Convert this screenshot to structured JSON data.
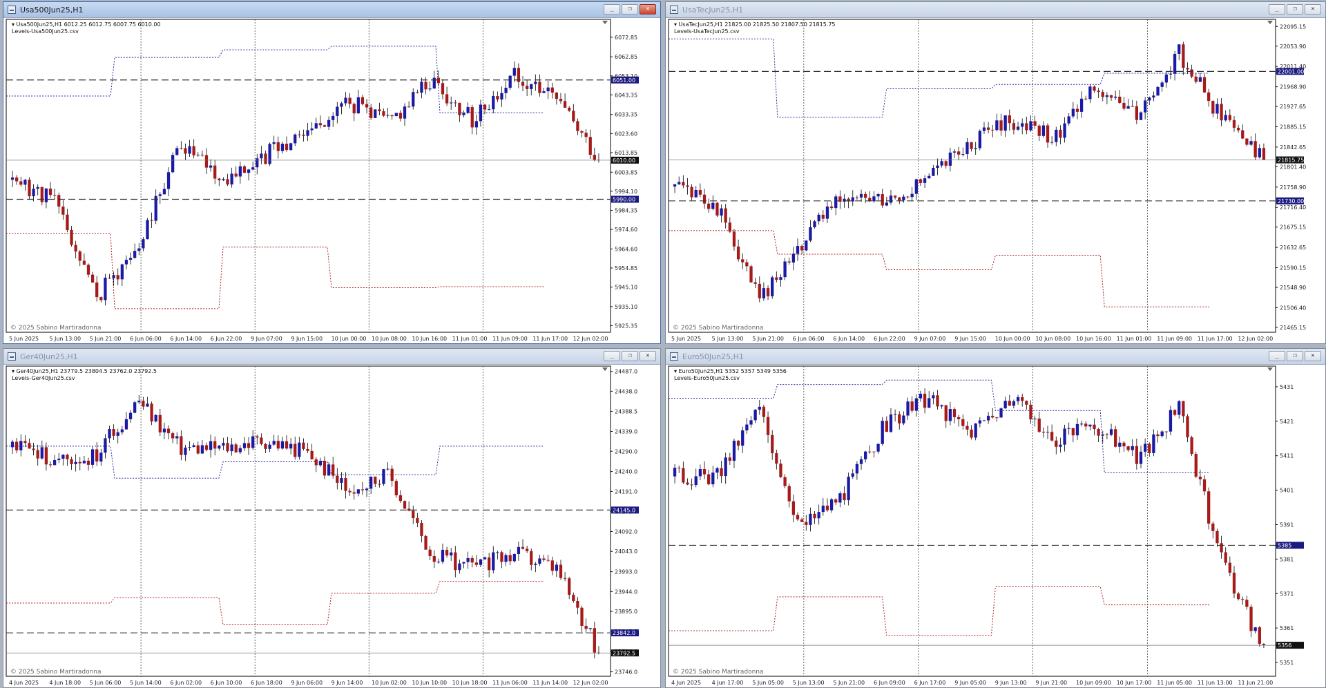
{
  "windows": [
    {
      "id": "w1",
      "title": "Usa500Jun25,H1",
      "active": true,
      "header_line": "Usa500Jun25,H1  6012.25 6012.75 6007.75 6010.00",
      "indicator": "Levels-Usa500Jun25.csv",
      "copyright": "© 2025 Sabino Martiradonna",
      "y_ticks": [
        "6072.85",
        "6062.85",
        "6053.10",
        "6043.35",
        "6033.35",
        "6023.60",
        "6013.85",
        "6003.85",
        "5994.10",
        "5984.35",
        "5974.60",
        "5964.60",
        "5954.85",
        "5945.10",
        "5935.10",
        "5925.35"
      ],
      "x_labels": [
        "5 Jun 2025",
        "5 Jun 13:00",
        "5 Jun 21:00",
        "6 Jun 06:00",
        "6 Jun 14:00",
        "6 Jun 22:00",
        "9 Jun 07:00",
        "9 Jun 15:00",
        "10 Jun 00:00",
        "10 Jun 08:00",
        "10 Jun 16:00",
        "11 Jun 01:00",
        "11 Jun 09:00",
        "11 Jun 17:00",
        "12 Jun 02:00"
      ],
      "levels": [
        {
          "value": 6051.0,
          "label": "6051.00"
        },
        {
          "value": 5990.0,
          "label": "5990.00"
        }
      ],
      "current_price": {
        "value": 6010.0,
        "label": "6010.00"
      },
      "ylim": [
        5922,
        6082
      ],
      "start": 6000,
      "trend": [
        6000,
        5990,
        5940,
        5965,
        6020,
        6000,
        6012,
        6025,
        6040,
        6030,
        6052,
        6030,
        6055,
        6040,
        6010
      ],
      "seed": 11
    },
    {
      "id": "w2",
      "title": "UsaTecJun25,H1",
      "active": false,
      "header_line": "UsaTecJun25,H1  21825.00 21825.50 21807.50 21815.75",
      "indicator": "Levels-UsaTecJun25.csv",
      "copyright": "© 2025 Sabino Martiradonna",
      "y_ticks": [
        "22095.15",
        "22053.90",
        "22011.40",
        "21968.90",
        "21927.65",
        "21885.15",
        "21842.65",
        "21801.40",
        "21758.90",
        "21716.40",
        "21675.15",
        "21632.65",
        "21590.15",
        "21548.90",
        "21506.40",
        "21465.15"
      ],
      "x_labels": [
        "5 Jun 2025",
        "5 Jun 13:00",
        "5 Jun 21:00",
        "6 Jun 06:00",
        "6 Jun 14:00",
        "6 Jun 22:00",
        "9 Jun 07:00",
        "9 Jun 15:00",
        "10 Jun 00:00",
        "10 Jun 08:00",
        "10 Jun 16:00",
        "11 Jun 01:00",
        "11 Jun 09:00",
        "11 Jun 17:00",
        "12 Jun 02:00"
      ],
      "levels": [
        {
          "value": 22001.0,
          "label": "22001.00"
        },
        {
          "value": 21730.0,
          "label": "21730.00"
        }
      ],
      "current_price": {
        "value": 21815.75,
        "label": "21815.75"
      },
      "ylim": [
        21455,
        22110
      ],
      "start": 21760,
      "trend": [
        21760,
        21720,
        21520,
        21640,
        21750,
        21730,
        21780,
        21850,
        21900,
        21860,
        21980,
        21900,
        22040,
        21900,
        21815
      ],
      "seed": 23
    },
    {
      "id": "w3",
      "title": "Ger40Jun25,H1",
      "active": false,
      "header_line": "Ger40Jun25,H1  23779.5 23804.5 23762.0 23792.5",
      "indicator": "Levels-Ger40Jun25.csv",
      "copyright": "© 2025 Sabino Martiradonna",
      "y_ticks": [
        "24487.0",
        "24438.0",
        "24388.5",
        "24339.0",
        "24290.0",
        "24240.0",
        "24191.0",
        "24141.5",
        "24092.0",
        "24043.0",
        "23993.0",
        "23944.0",
        "23895.0",
        "23845.5",
        "23796.0",
        "23746.0"
      ],
      "x_labels": [
        "4 Jun 2025",
        "4 Jun 18:00",
        "5 Jun 06:00",
        "5 Jun 14:00",
        "6 Jun 02:00",
        "6 Jun 10:00",
        "6 Jun 18:00",
        "9 Jun 06:00",
        "9 Jun 14:00",
        "10 Jun 02:00",
        "10 Jun 10:00",
        "10 Jun 18:00",
        "11 Jun 06:00",
        "11 Jun 14:00",
        "12 Jun 02:00"
      ],
      "levels": [
        {
          "value": 24145.0,
          "label": "24145.0"
        },
        {
          "value": 23842.0,
          "label": "23842.0"
        }
      ],
      "current_price": {
        "value": 23792.5,
        "label": "23792.5"
      },
      "ylim": [
        23735,
        24500
      ],
      "start": 24300,
      "trend": [
        24300,
        24270,
        24280,
        24420,
        24300,
        24300,
        24320,
        24290,
        24200,
        24230,
        24040,
        24000,
        24040,
        24000,
        23790
      ],
      "seed": 37
    },
    {
      "id": "w4",
      "title": "Euro50Jun25,H1",
      "active": false,
      "header_line": "Euro50Jun25,H1  5352 5357 5349 5356",
      "indicator": "Levels-Euro50Jun25.csv",
      "copyright": "© 2025 Sabino Martiradonna",
      "y_ticks": [
        "5431",
        "5421",
        "5411",
        "5401",
        "5391",
        "5385",
        "5381",
        "5371",
        "5361",
        "5356",
        "5351"
      ],
      "x_labels": [
        "4 Jun 2025",
        "4 Jun 17:00",
        "5 Jun 05:00",
        "5 Jun 13:00",
        "5 Jun 21:00",
        "6 Jun 09:00",
        "6 Jun 17:00",
        "9 Jun 05:00",
        "9 Jun 13:00",
        "9 Jun 21:00",
        "10 Jun 09:00",
        "10 Jun 17:00",
        "11 Jun 05:00",
        "11 Jun 13:00",
        "11 Jun 21:00"
      ],
      "levels": [
        {
          "value": 5385,
          "label": "5385"
        }
      ],
      "current_price": {
        "value": 5356,
        "label": "5356"
      },
      "ylim": [
        5347,
        5437
      ],
      "start": 5405,
      "trend": [
        5405,
        5405,
        5425,
        5390,
        5400,
        5420,
        5428,
        5418,
        5428,
        5415,
        5420,
        5410,
        5425,
        5380,
        5355
      ],
      "seed": 51
    }
  ],
  "colors": {
    "bull": "#1a1aa6",
    "bear": "#a61a1a",
    "grid": "#404040",
    "level_upper": "#2a2aa0",
    "level_lower": "#b02020",
    "price_tag": "#1a1a80"
  },
  "icons": {
    "minimize": "minimize-icon",
    "restore": "restore-icon",
    "close": "close-icon"
  }
}
